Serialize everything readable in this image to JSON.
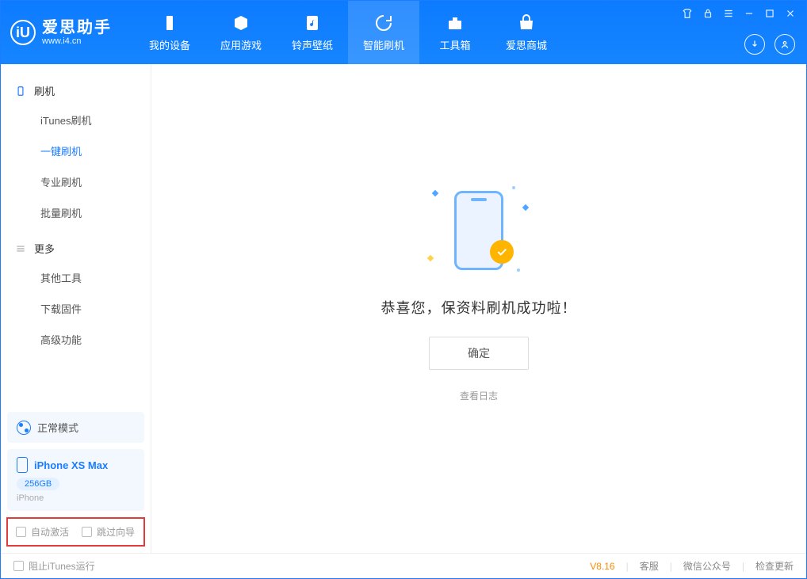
{
  "logo": {
    "letter": "iU",
    "title": "爱思助手",
    "url": "www.i4.cn"
  },
  "nav": [
    {
      "label": "我的设备",
      "icon": "device"
    },
    {
      "label": "应用游戏",
      "icon": "cube"
    },
    {
      "label": "铃声壁纸",
      "icon": "music"
    },
    {
      "label": "智能刷机",
      "icon": "refresh",
      "active": true
    },
    {
      "label": "工具箱",
      "icon": "toolbox"
    },
    {
      "label": "爱思商城",
      "icon": "shop"
    }
  ],
  "sidebar": {
    "group1": {
      "title": "刷机"
    },
    "items1": [
      "iTunes刷机",
      "一键刷机",
      "专业刷机",
      "批量刷机"
    ],
    "activeIndex1": 1,
    "group2": {
      "title": "更多"
    },
    "items2": [
      "其他工具",
      "下载固件",
      "高级功能"
    ]
  },
  "mode": {
    "label": "正常模式"
  },
  "device": {
    "name": "iPhone XS Max",
    "storage": "256GB",
    "type": "iPhone"
  },
  "checks": {
    "auto_activate": "自动激活",
    "skip_guide": "跳过向导"
  },
  "main": {
    "message": "恭喜您，保资料刷机成功啦！",
    "ok": "确定",
    "viewlog": "查看日志"
  },
  "footer": {
    "block_itunes": "阻止iTunes运行",
    "version": "V8.16",
    "service": "客服",
    "wechat": "微信公众号",
    "update": "检查更新"
  }
}
